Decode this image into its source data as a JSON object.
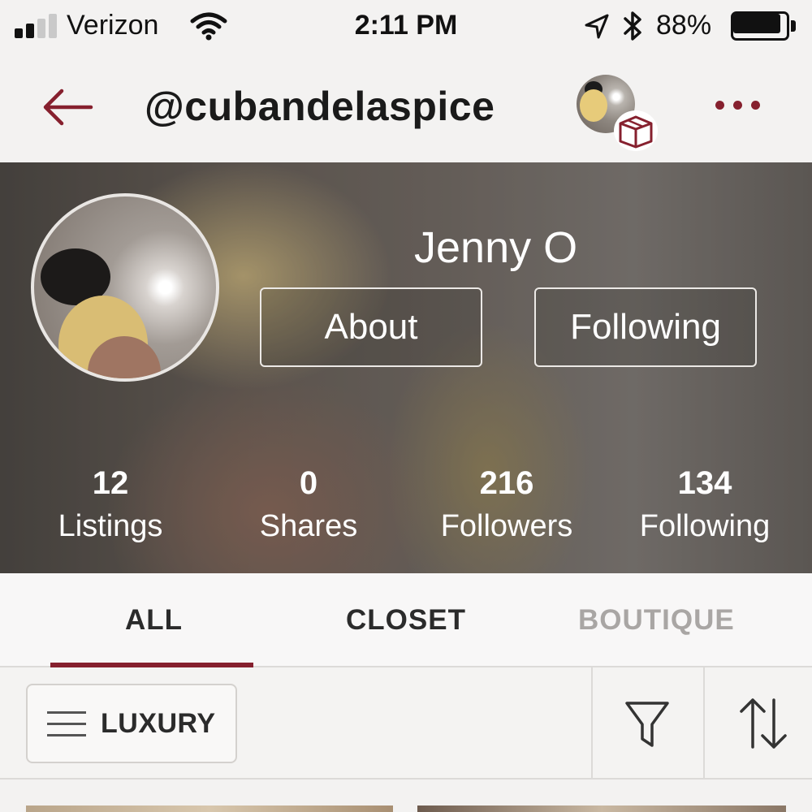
{
  "status_bar": {
    "carrier": "Verizon",
    "time": "2:11 PM",
    "battery_percent": "88%",
    "battery_level": 0.88,
    "signal_bars_filled": 2,
    "signal_bars_total": 4,
    "icons": [
      "signal-icon",
      "wifi-icon",
      "location-arrow-icon",
      "bluetooth-icon",
      "battery-icon"
    ]
  },
  "header": {
    "username": "@cubandelaspice",
    "back_icon": "arrow-left-icon",
    "more_icon": "ellipsis-icon",
    "bundle_icon": "box-icon"
  },
  "profile": {
    "display_name": "Jenny O",
    "about_label": "About",
    "following_button_label": "Following",
    "stats": [
      {
        "value": "12",
        "label": "Listings"
      },
      {
        "value": "0",
        "label": "Shares"
      },
      {
        "value": "216",
        "label": "Followers"
      },
      {
        "value": "134",
        "label": "Following"
      }
    ]
  },
  "tabs": [
    {
      "label": "ALL",
      "active": true
    },
    {
      "label": "CLOSET",
      "active": false
    },
    {
      "label": "BOUTIQUE",
      "active": false,
      "disabled": true
    }
  ],
  "filters": {
    "category_label": "LUXURY",
    "category_icon": "hamburger-menu-icon",
    "filter_icon": "funnel-icon",
    "sort_icon": "sort-arrows-icon"
  },
  "colors": {
    "accent": "#86202e",
    "background": "#f3f2f1",
    "inactive_tab": "#a9a6a4"
  }
}
